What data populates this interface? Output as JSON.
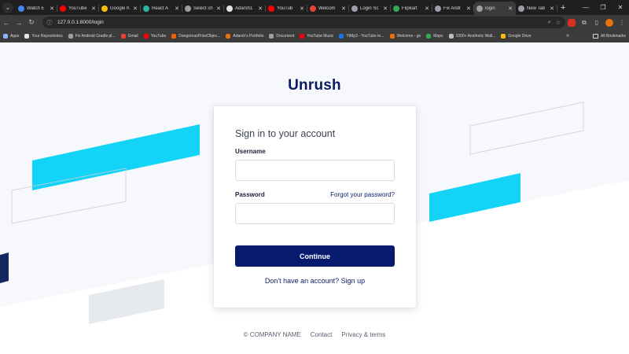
{
  "browser": {
    "tabs": [
      {
        "label": "Watch E",
        "icon": "watch-favicon",
        "color": "#4285f4"
      },
      {
        "label": "YouTube",
        "icon": "youtube-favicon",
        "color": "#ff0000"
      },
      {
        "label": "Google K",
        "icon": "keep-favicon",
        "color": "#fbbc04"
      },
      {
        "label": "React A",
        "icon": "react-favicon",
        "color": "#2bb3a0"
      },
      {
        "label": "Select ch",
        "icon": "globe-favicon",
        "color": "#9aa0a6"
      },
      {
        "label": "Adarsh1",
        "icon": "github-favicon",
        "color": "#e3e3e3"
      },
      {
        "label": "YouTub",
        "icon": "youtube-music-favicon",
        "color": "#ff0000"
      },
      {
        "label": "Welcom",
        "icon": "gmail-favicon",
        "color": "#ea4335"
      },
      {
        "label": "Login Sc",
        "icon": "loader-favicon",
        "color": "#9aa0a6"
      },
      {
        "label": "Flipkart",
        "icon": "google-favicon",
        "color": "#34a853"
      },
      {
        "label": "Fix Andr",
        "icon": "globe-favicon",
        "color": "#9aa0a6"
      },
      {
        "label": "login",
        "icon": "globe-favicon",
        "color": "#9aa0a6",
        "active": true
      },
      {
        "label": "New Tab",
        "icon": "chrome-favicon",
        "color": "#9aa0a6"
      }
    ],
    "address": "127.0.0.1:8000/login",
    "bookmarks": [
      {
        "label": "Apps",
        "icon": "apps-grid-icon",
        "color": "#8ab4f8"
      },
      {
        "label": "Your Repositories",
        "icon": "github-icon",
        "color": "#e3e3e3"
      },
      {
        "label": "Fix Android Gradle pl...",
        "icon": "globe-icon",
        "color": "#9aa0a6"
      },
      {
        "label": "Gmail",
        "icon": "gmail-icon",
        "color": "#ea4335"
      },
      {
        "label": "YouTube",
        "icon": "youtube-icon",
        "color": "#ff0000"
      },
      {
        "label": "DangerousPrizeObjec...",
        "icon": "replit-icon",
        "color": "#f26207"
      },
      {
        "label": "Adarsh's Portfolio",
        "icon": "portfolio-icon",
        "color": "#e8710a"
      },
      {
        "label": "Document",
        "icon": "globe-icon",
        "color": "#9aa0a6"
      },
      {
        "label": "YouTube Music",
        "icon": "youtube-music-icon",
        "color": "#ff0000"
      },
      {
        "label": "YtMp3 - YouTube to...",
        "icon": "ytmp3-icon",
        "color": "#1a73e8"
      },
      {
        "label": "Welcome - go",
        "icon": "welcome-icon",
        "color": "#e8710a"
      },
      {
        "label": "Maps",
        "icon": "maps-icon",
        "color": "#34a853"
      },
      {
        "label": "1000+ Aesthetic Wall...",
        "icon": "wallpaper-icon",
        "color": "#bdbdbd"
      },
      {
        "label": "Google Drive",
        "icon": "drive-icon",
        "color": "#fbbc04"
      }
    ],
    "all_bookmarks": "All Bookmarks"
  },
  "page": {
    "brand": "Unrush",
    "card": {
      "title": "Sign in to your account",
      "username_label": "Username",
      "password_label": "Password",
      "forgot": "Forgot your password?",
      "continue": "Continue",
      "signup": "Don't have an account? Sign up"
    },
    "footer": {
      "copyright": "© COMPANY NAME",
      "contact": "Contact",
      "privacy": "Privacy & terms"
    },
    "colors": {
      "brand": "#0b1b63",
      "button": "#081a6d",
      "accent_stripe": "#13d4f7"
    }
  }
}
